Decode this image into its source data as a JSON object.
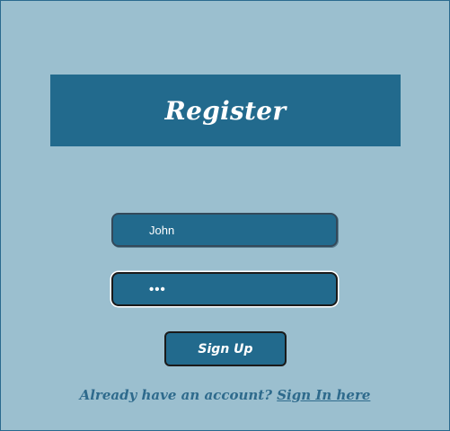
{
  "header": {
    "title": "Register"
  },
  "form": {
    "username_value": "John",
    "password_value": "***",
    "submit_label": "Sign Up"
  },
  "footer": {
    "prompt_text": "Already have an account?",
    "link_text": "Sign In here"
  },
  "colors": {
    "page_background": "#9bbfcf",
    "primary": "#226a8d",
    "text_light": "#ffffff",
    "footer_text": "#2e6a8c"
  }
}
